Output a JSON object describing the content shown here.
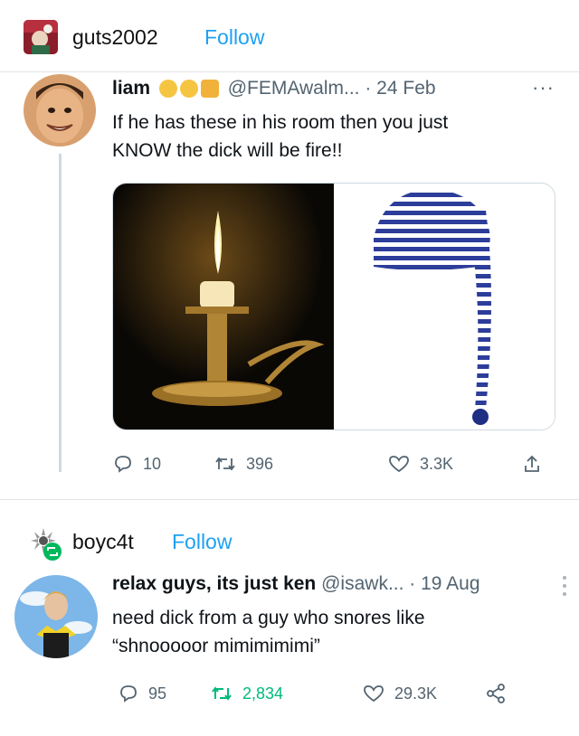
{
  "post1": {
    "blog_name": "guts2002",
    "follow_label": "Follow",
    "tweet": {
      "display_name": "liam",
      "handle": "@FEMAwalm...",
      "date": "· 24 Feb",
      "more": "···",
      "text_line1": "If he has these in his room then you just",
      "text_line2": "KNOW the dick will be fire!!",
      "replies": "10",
      "retweets": "396",
      "likes": "3.3K"
    }
  },
  "post2": {
    "blog_name": "boyc4t",
    "follow_label": "Follow",
    "tweet": {
      "display_name": "relax guys, its just ken",
      "handle": "@isawk...",
      "date": "· 19 Aug",
      "text_line1": "need dick from a guy who snores like",
      "text_line2": "“shnooooor mimimimimi”",
      "replies": "95",
      "retweets": "2,834",
      "likes": "29.3K"
    }
  },
  "colors": {
    "follow": "#1da1f2",
    "retweet_active": "#00ba7c",
    "muted": "#536471",
    "thread_line": "#cfd9de"
  },
  "icons": [
    "reply-icon",
    "retweet-icon",
    "like-icon",
    "share-icon",
    "more-icon",
    "reblog-badge-icon"
  ]
}
